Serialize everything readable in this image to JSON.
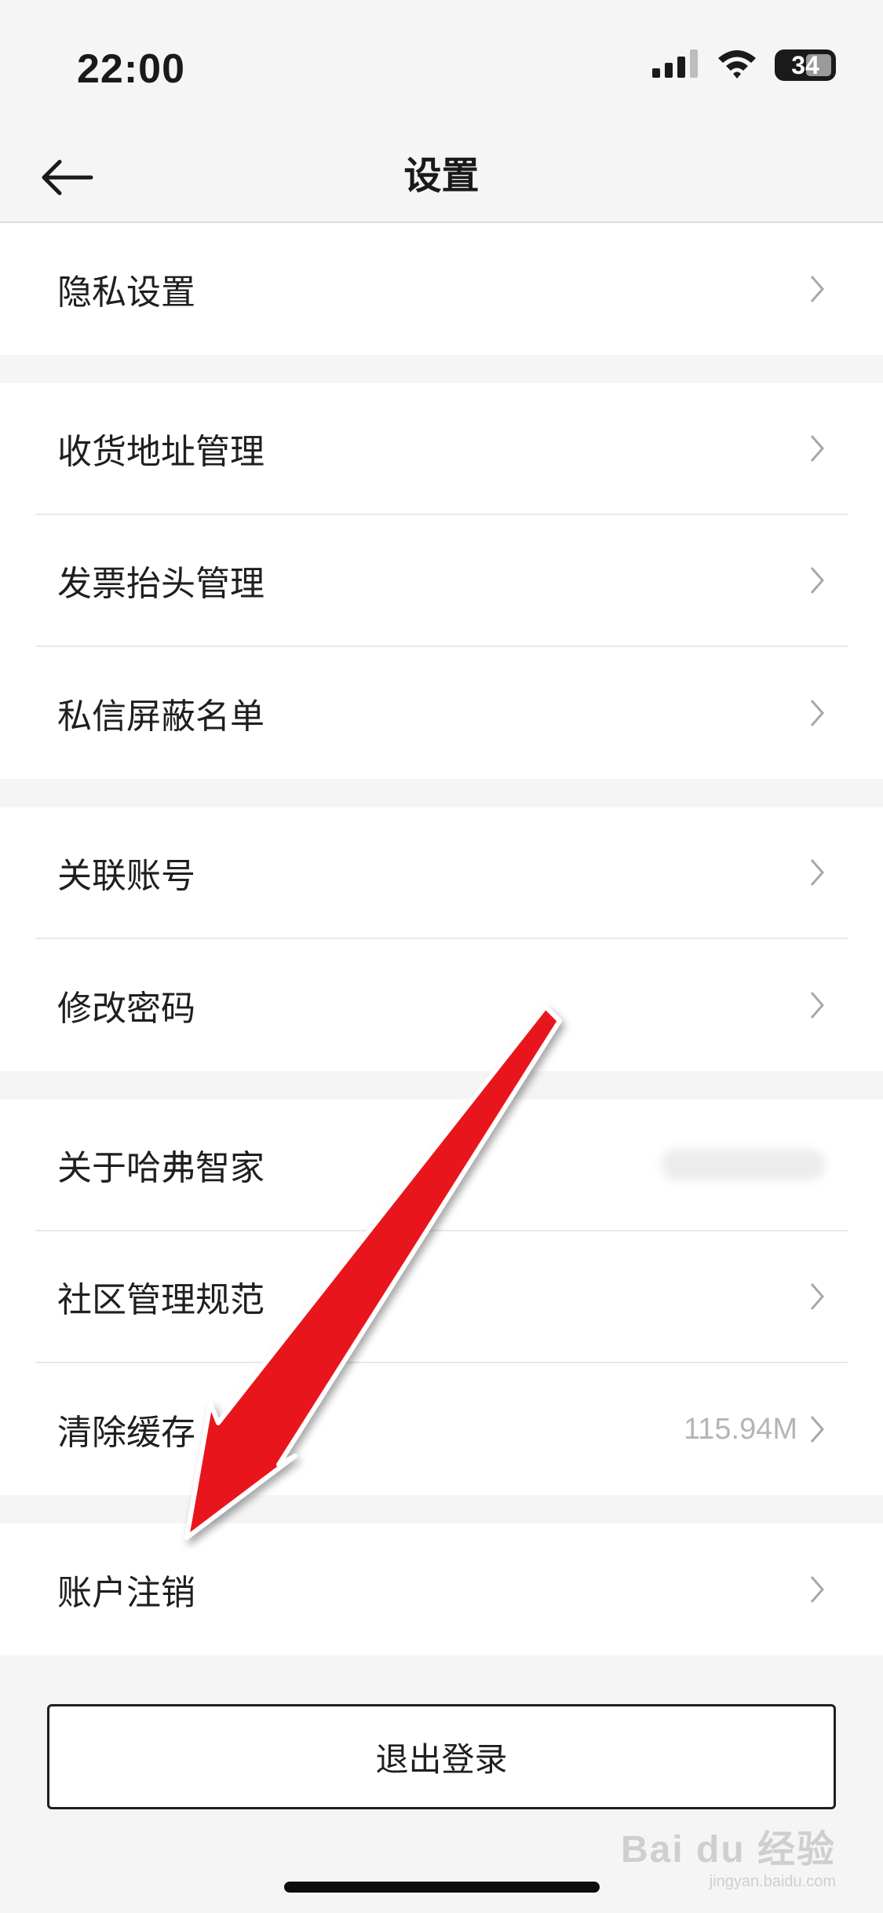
{
  "status_bar": {
    "time": "22:00",
    "battery": "34",
    "icons": [
      "signal-icon",
      "wifi-icon",
      "battery-icon"
    ]
  },
  "nav": {
    "title": "设置",
    "back_icon": "arrow-left-icon"
  },
  "groups": [
    {
      "items": [
        {
          "label": "隐私设置"
        }
      ]
    },
    {
      "items": [
        {
          "label": "收货地址管理"
        },
        {
          "label": "发票抬头管理"
        },
        {
          "label": "私信屏蔽名单"
        }
      ]
    },
    {
      "items": [
        {
          "label": "关联账号"
        },
        {
          "label": "修改密码"
        }
      ]
    },
    {
      "items": [
        {
          "label": "关于哈弗智家"
        },
        {
          "label": "社区管理规范"
        },
        {
          "label": "清除缓存",
          "value": "115.94M"
        }
      ]
    },
    {
      "items": [
        {
          "label": "账户注销"
        }
      ]
    }
  ],
  "logout": {
    "label": "退出登录"
  },
  "watermark": {
    "logo": "Bai du 经验",
    "url": "jingyan.baidu.com"
  },
  "colors": {
    "background": "#f5f5f5",
    "card": "#ffffff",
    "text": "#1f1f1f",
    "muted": "#b5b5b5",
    "annotation_arrow": "#e8141b"
  }
}
